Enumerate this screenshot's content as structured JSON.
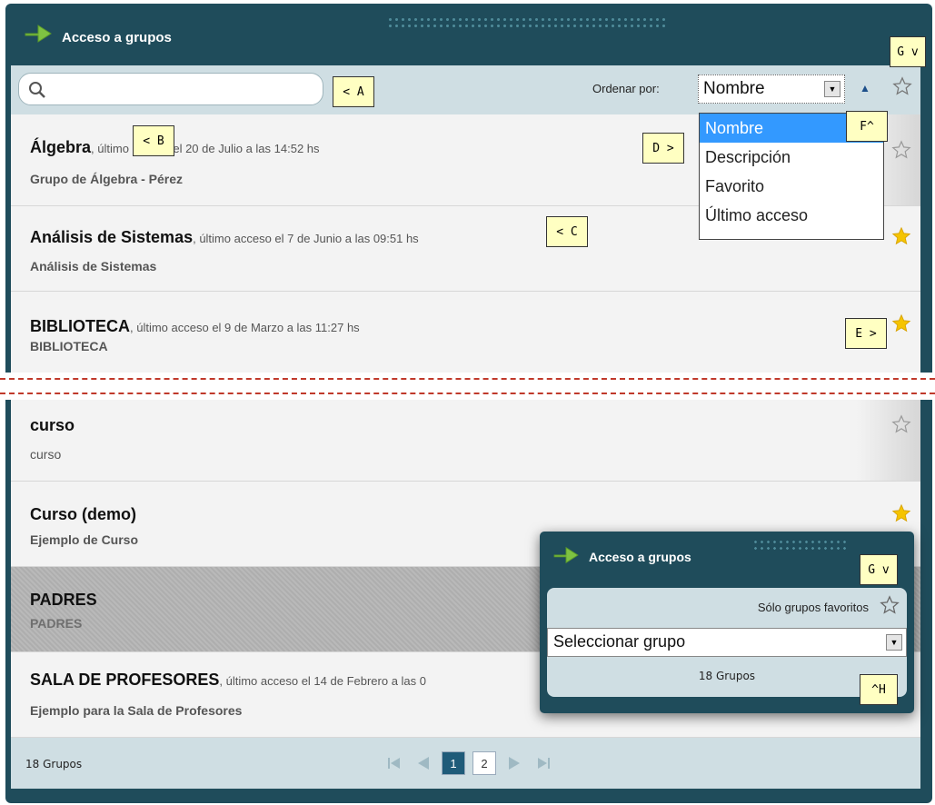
{
  "header": {
    "title": "Acceso a grupos"
  },
  "toolbar": {
    "search_placeholder": "",
    "order_label": "Ordenar por:",
    "order_value": "Nombre"
  },
  "sort_options": [
    "Nombre",
    "Descripción",
    "Favorito",
    "Último acceso"
  ],
  "groups": [
    {
      "name": "Álgebra",
      "meta": ", último acceso el 20 de Julio a las 14:52 hs",
      "desc": "Grupo de Álgebra - Pérez",
      "favorite": false
    },
    {
      "name": "Análisis de Sistemas",
      "meta": ", último acceso el 7 de Junio a las 09:51 hs",
      "desc": "Análisis de Sistemas",
      "favorite": true
    },
    {
      "name": "BIBLIOTECA",
      "meta": ", último acceso el 9 de Marzo a las 11:27 hs",
      "desc": "BIBLIOTECA",
      "favorite": true
    },
    {
      "name": "curso",
      "meta": "",
      "desc": "curso",
      "favorite": false
    },
    {
      "name": "Curso (demo)",
      "meta": "",
      "desc": "Ejemplo de Curso",
      "favorite": true
    },
    {
      "name": "PADRES",
      "meta": "",
      "desc": "PADRES",
      "favorite": false
    },
    {
      "name": "SALA DE PROFESORES",
      "meta": ", último acceso el 14 de Febrero a las 0",
      "desc": "Ejemplo para la Sala de Profesores",
      "favorite": false
    }
  ],
  "footer": {
    "count": "18 Grupos",
    "pages": [
      "1",
      "2"
    ],
    "current_page": "1"
  },
  "callouts": {
    "a": "< A",
    "b": "< B",
    "c": "< C",
    "d": "D >",
    "e": "E >",
    "f": "F^",
    "g": "G v",
    "g2": "G v",
    "h": "^H"
  },
  "mini_widget": {
    "title": "Acceso a grupos",
    "favorites_label": "Sólo grupos favoritos",
    "select_value": "Seleccionar grupo",
    "count": "18 Grupos"
  },
  "colors": {
    "panel": "#1f4c5b",
    "bar": "#cfdee3",
    "star_fav": "#f5c400",
    "highlight": "#3399ff",
    "callout": "#ffffc2"
  }
}
